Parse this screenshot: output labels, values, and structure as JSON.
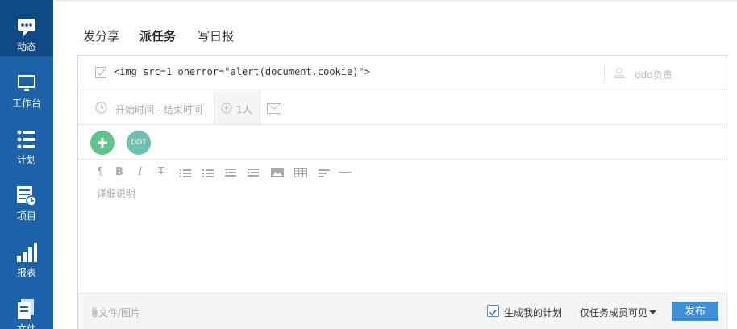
{
  "sidebar": {
    "items": [
      {
        "label": "动态",
        "icon": "chat-icon"
      },
      {
        "label": "工作台",
        "icon": "monitor-icon"
      },
      {
        "label": "计划",
        "icon": "list-icon"
      },
      {
        "label": "项目",
        "icon": "project-icon"
      },
      {
        "label": "报表",
        "icon": "bar-chart-icon"
      },
      {
        "label": "文件",
        "icon": "file-icon"
      }
    ]
  },
  "tabs": [
    {
      "label": "发分享"
    },
    {
      "label": "派任务",
      "active": true
    },
    {
      "label": "写日报"
    }
  ],
  "task": {
    "title_value": "<img src=1 onerror=\"alert(document.cookie)\">",
    "assignee": "ddd负责",
    "time_range": "开始时间 - 结束时间",
    "members": "1人",
    "avatar_initials": "DDT",
    "description_placeholder": "详细说明"
  },
  "footer": {
    "attach_label": "文件/图片",
    "generate_plan_label": "生成我的计划",
    "generate_plan_checked": true,
    "visibility_label": "仅任务成员可见",
    "publish_label": "发布"
  },
  "colors": {
    "sidebar": "#1b62a8",
    "sidebar_active": "#104a85",
    "accent_button": "#3d8fd6",
    "add_button": "#5ec48a",
    "avatar": "#6bc0b0"
  }
}
